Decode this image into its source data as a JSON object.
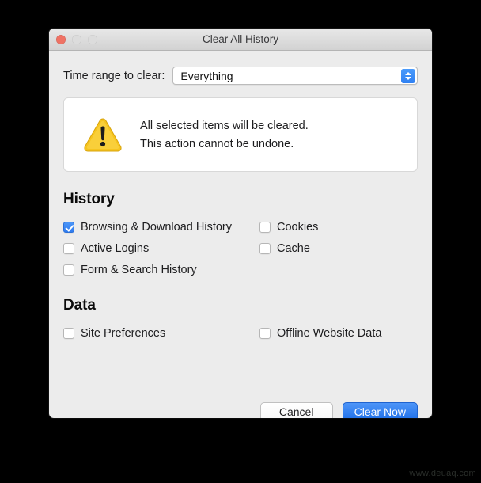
{
  "window": {
    "title": "Clear All History",
    "traffic_lights": [
      {
        "name": "close",
        "color": "#ef7264"
      },
      {
        "name": "minimize",
        "color": "#dcdcdc"
      },
      {
        "name": "maximize",
        "color": "#dcdcdc"
      }
    ]
  },
  "time_range": {
    "label": "Time range to clear:",
    "value": "Everything"
  },
  "warning": {
    "icon": "warning-triangle-icon",
    "line1": "All selected items will be cleared.",
    "line2": "This action cannot be undone."
  },
  "history": {
    "heading": "History",
    "rows": [
      {
        "left": {
          "label": "Browsing & Download History",
          "checked": true
        },
        "right": {
          "label": "Cookies",
          "checked": false
        }
      },
      {
        "left": {
          "label": "Active Logins",
          "checked": false
        },
        "right": {
          "label": "Cache",
          "checked": false
        }
      },
      {
        "left": {
          "label": "Form & Search History",
          "checked": false
        },
        "right": {
          "label": "",
          "checked": false
        }
      }
    ]
  },
  "data_section": {
    "heading": "Data",
    "rows": [
      {
        "left": {
          "label": "Site Preferences",
          "checked": false
        },
        "right": {
          "label": "Offline Website Data",
          "checked": false
        }
      }
    ]
  },
  "buttons": {
    "cancel": "Cancel",
    "confirm": "Clear Now"
  },
  "watermark": "www.deuaq.com",
  "colors": {
    "accent_blue": "#2f7cf0",
    "warning_yellow": "#f5c21e",
    "close_red": "#ef7264",
    "window_bg": "#ececec",
    "backdrop": "#000000"
  }
}
